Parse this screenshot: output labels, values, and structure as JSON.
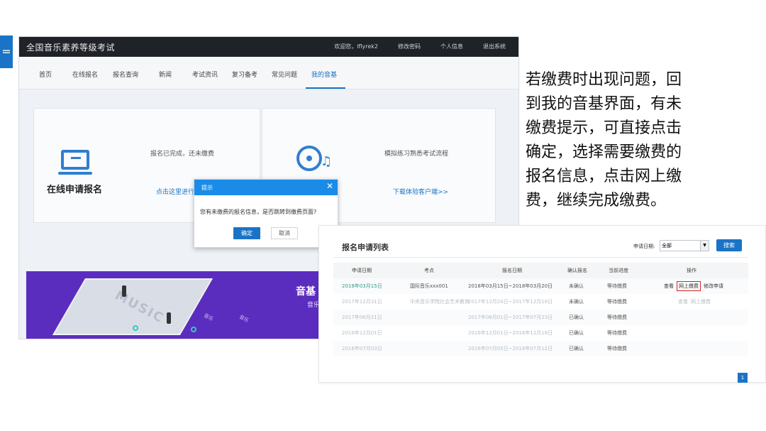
{
  "side_marker": "=",
  "site": {
    "title": "全国音乐素养等级考试",
    "top_links": [
      "欢迎您，lflyrek2",
      "修改密码",
      "个人信息",
      "退出系统"
    ]
  },
  "nav": {
    "items": [
      "首页",
      "在线报名",
      "报名查询",
      "新闻",
      "考试资讯",
      "复习备考",
      "常见问题",
      "我的音基"
    ],
    "active_index": 7
  },
  "panels": {
    "left": {
      "title": "在线申请报名",
      "status": "报名已完成，还未缴费",
      "link": "点击这里进行"
    },
    "right": {
      "status": "模拟练习熟悉考试流程",
      "link": "下载体验客户端>>"
    }
  },
  "banner": {
    "platform_label": "MUSIC",
    "text": "音基",
    "sub": "音乐",
    "tags": [
      "音乐",
      "音乐"
    ]
  },
  "dialog": {
    "title": "提示",
    "close": "✕",
    "message": "您有未缴费的报名信息，是否跳转到缴费页面?",
    "ok": "确定",
    "cancel": "取消"
  },
  "instruction": {
    "lines": [
      "若缴费时出现问题，回",
      "到我的音基界面，有未",
      "缴费提示，可直接点击",
      "确定，选择需要缴费的",
      "报名信息，点击网上缴",
      "费，继续完成缴费。"
    ]
  },
  "table": {
    "title": "报名申请列表",
    "filter_label": "申请日期:",
    "filter_value": "全部",
    "search": "搜索",
    "headers": [
      "申请日期",
      "考点",
      "报名日期",
      "确认报名",
      "当前进度",
      "操作"
    ],
    "rows": [
      {
        "date": "2018年03月15日",
        "site": "国际音乐xxx001",
        "period": "2018年03月15日~2018年03月20日",
        "confirm": "未确认",
        "progress": "等待缴费",
        "actions": [
          "查看",
          "网上缴费",
          "修改申请"
        ],
        "highlight": 1,
        "faded": false
      },
      {
        "date": "2017年12月31日",
        "site": "中央音乐学院社会艺术教育",
        "period": "2017年12月24日~2017年12月18日",
        "confirm": "未确认",
        "progress": "等待缴费",
        "actions": [
          "查看",
          "网上缴费"
        ],
        "highlight": -1,
        "faded": true
      },
      {
        "date": "2017年06月21日",
        "site": "",
        "period": "2017年06月01日~2017年07月23日",
        "confirm": "已确认",
        "progress": "等待缴费",
        "actions": [],
        "highlight": -1,
        "faded": true
      },
      {
        "date": "2016年12月01日",
        "site": "",
        "period": "2016年12月01日~2016年12月18日",
        "confirm": "已确认",
        "progress": "等待缴费",
        "actions": [],
        "highlight": -1,
        "faded": true
      },
      {
        "date": "2016年07月03日",
        "site": "",
        "period": "2016年07月05日~2016年07月12日",
        "confirm": "已确认",
        "progress": "等待缴费",
        "actions": [],
        "highlight": -1,
        "faded": true
      }
    ],
    "page": "1"
  }
}
